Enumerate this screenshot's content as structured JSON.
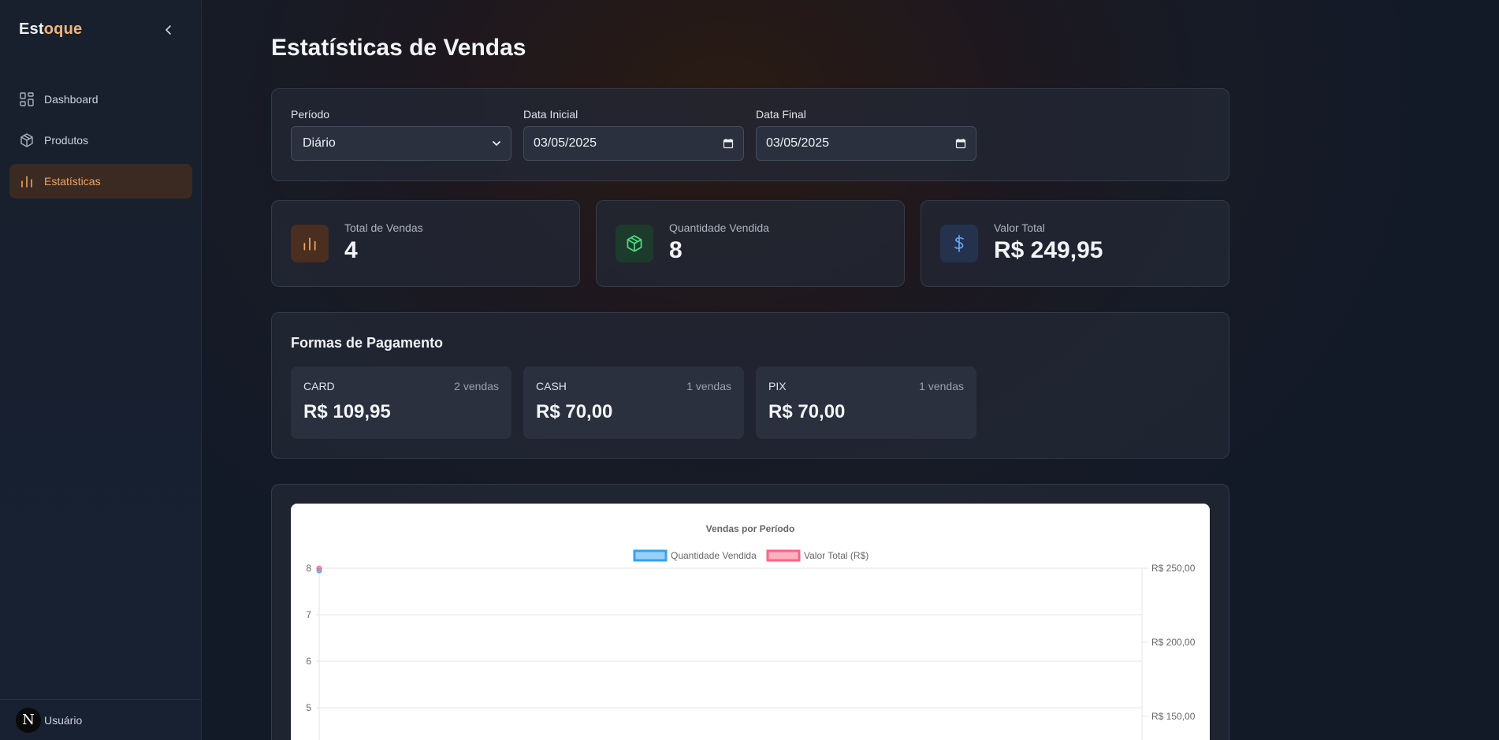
{
  "sidebar": {
    "brand_part1": "Est",
    "brand_part2": "oque",
    "items": [
      {
        "label": "Dashboard",
        "icon": "grid-icon"
      },
      {
        "label": "Produtos",
        "icon": "box-icon"
      },
      {
        "label": "Estatísticas",
        "icon": "bar-chart-icon",
        "active": true
      }
    ],
    "user": {
      "initial": "N",
      "name": "Usuário"
    }
  },
  "page": {
    "title": "Estatísticas de Vendas"
  },
  "filters": {
    "period_label": "Período",
    "period_value": "Diário",
    "start_label": "Data Inicial",
    "start_value": "03/05/2025",
    "end_label": "Data Final",
    "end_value": "03/05/2025"
  },
  "stats": [
    {
      "label": "Total de Vendas",
      "value": "4",
      "icon": "bar-chart-icon",
      "color": "#f4a261"
    },
    {
      "label": "Quantidade Vendida",
      "value": "8",
      "icon": "box-icon",
      "color": "#4ade80"
    },
    {
      "label": "Valor Total",
      "value": "R$ 249,95",
      "icon": "dollar-icon",
      "color": "#60a5fa"
    }
  ],
  "payments": {
    "title": "Formas de Pagamento",
    "methods": [
      {
        "name": "CARD",
        "count": "2 vendas",
        "value": "R$ 109,95"
      },
      {
        "name": "CASH",
        "count": "1 vendas",
        "value": "R$ 70,00"
      },
      {
        "name": "PIX",
        "count": "1 vendas",
        "value": "R$ 70,00"
      }
    ]
  },
  "chart_data": {
    "type": "line",
    "title": "Vendas por Período",
    "series": [
      {
        "name": "Quantidade Vendida",
        "values": [
          8
        ],
        "color": "#36a2eb",
        "axis": "left"
      },
      {
        "name": "Valor Total (R$)",
        "values": [
          249.95
        ],
        "color": "#ff6384",
        "axis": "right"
      }
    ],
    "left_ticks": [
      "8",
      "7",
      "6",
      "5"
    ],
    "right_ticks": [
      "R$ 250,00",
      "R$ 200,00",
      "R$ 150,00"
    ],
    "ylim_left": [
      0,
      8
    ],
    "ylim_right": [
      0,
      250
    ],
    "grid": true,
    "legend": "top"
  }
}
